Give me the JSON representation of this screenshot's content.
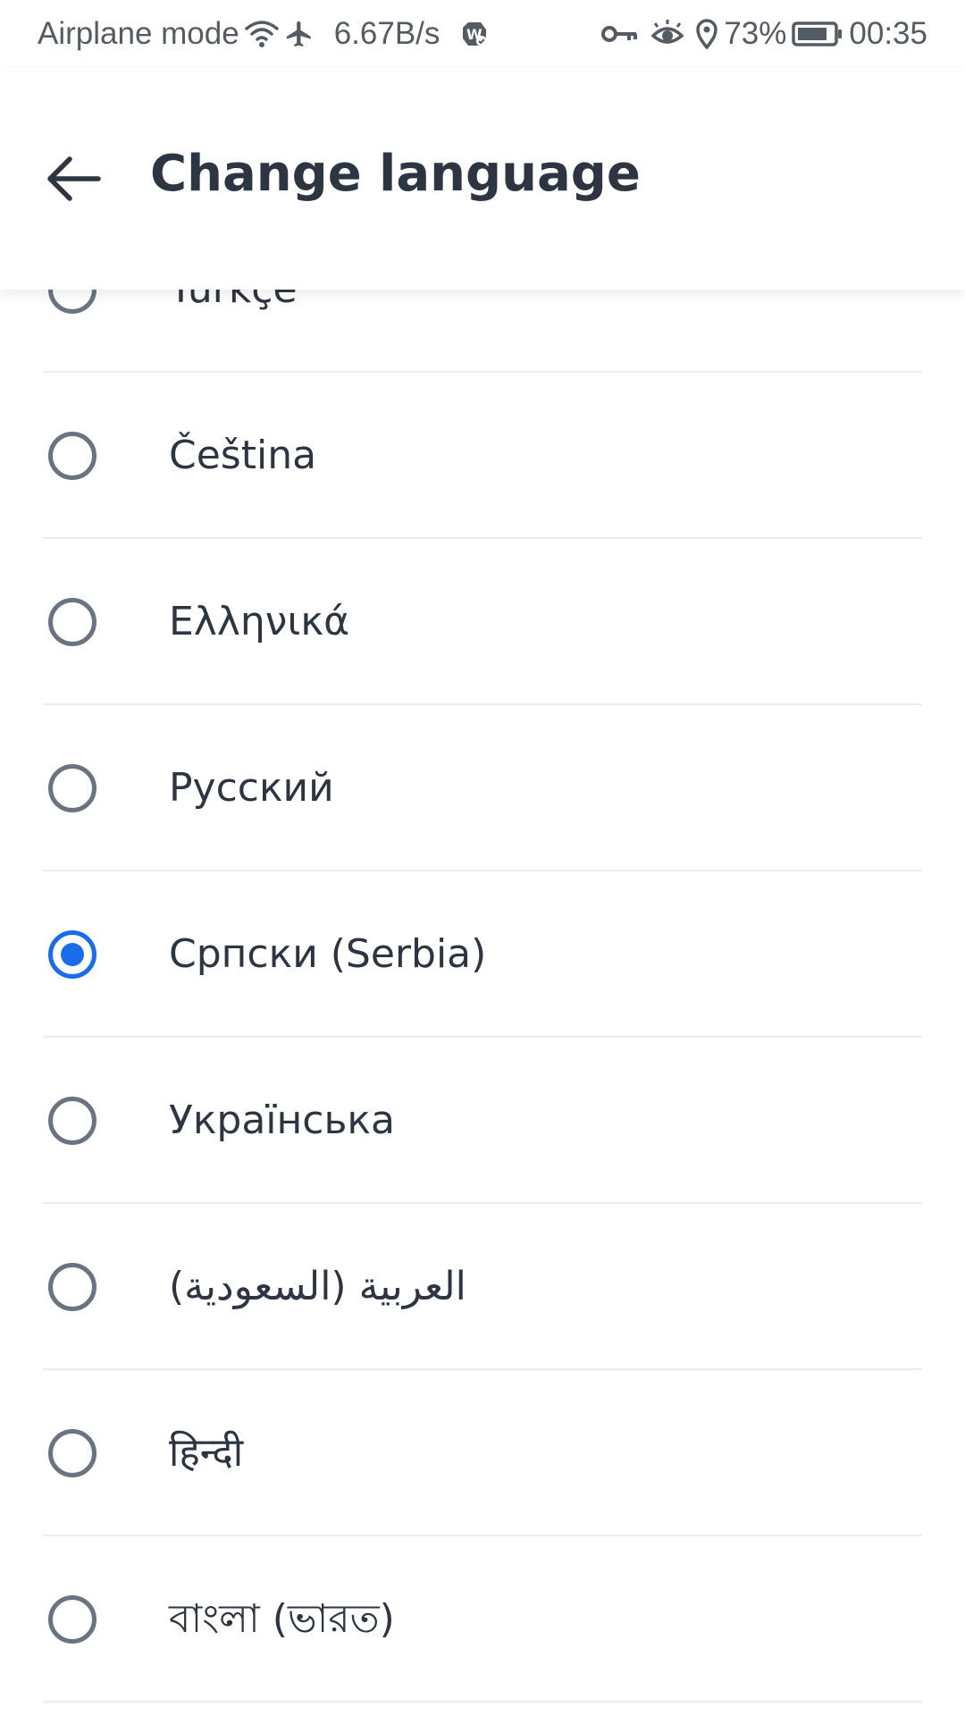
{
  "status_bar": {
    "network_status": "Airplane mode",
    "speed": "6.67B/s",
    "battery_percent": "73%",
    "time": "00:35",
    "icons": [
      "wifi-icon",
      "airplane-icon",
      "app-notification-icon",
      "vpn-key-icon",
      "eye-comfort-icon",
      "location-icon",
      "battery-icon"
    ]
  },
  "header": {
    "title": "Change language",
    "back_icon": "arrow-left-icon"
  },
  "languages": [
    {
      "label": "Türkçe",
      "selected": false
    },
    {
      "label": "Čeština",
      "selected": false
    },
    {
      "label": "Ελληνικά",
      "selected": false
    },
    {
      "label": "Русский",
      "selected": false
    },
    {
      "label": "Српски (Serbia)",
      "selected": true
    },
    {
      "label": "Українська",
      "selected": false
    },
    {
      "label": "العربية (السعودية)",
      "selected": false
    },
    {
      "label": "हिन्दी",
      "selected": false
    },
    {
      "label": "বাংলা (ভারত)",
      "selected": false
    }
  ],
  "colors": {
    "accent": "#1a6ce8",
    "text": "#2e3542",
    "radio_unselected": "#6b7383",
    "divider": "#ebedf0"
  }
}
